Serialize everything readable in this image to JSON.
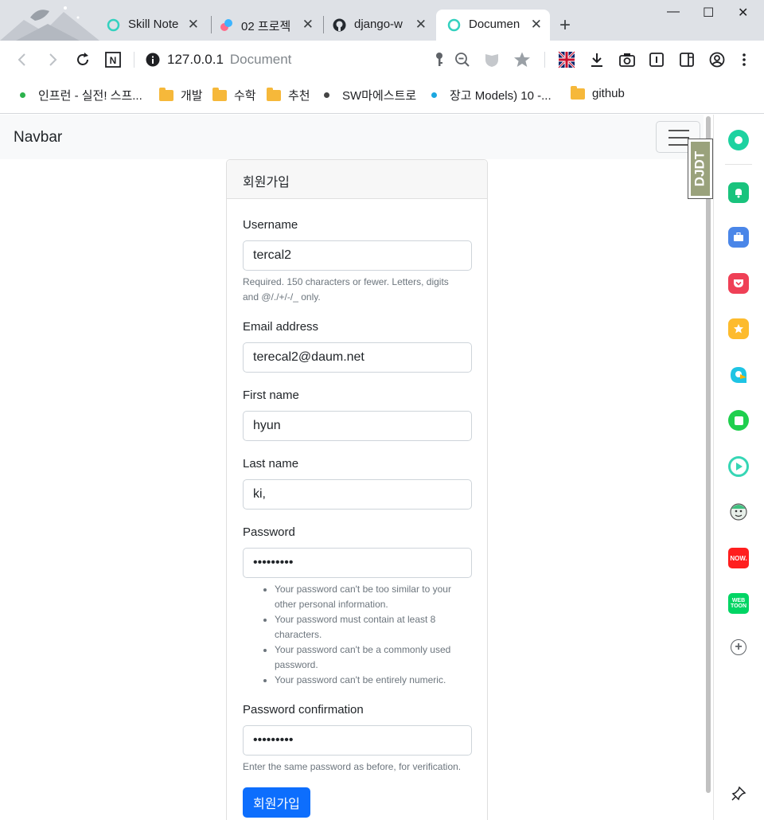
{
  "browser": {
    "tabs": [
      {
        "title": "Skill Note",
        "favicon": "circle-icon",
        "color": "#34d1bf"
      },
      {
        "title": "02 프로젝",
        "favicon": "app-icon",
        "color": "#ff6b8b"
      },
      {
        "title": "django-w",
        "favicon": "github-icon",
        "color": "#24292f"
      },
      {
        "title": "Documen",
        "favicon": "circle-icon",
        "color": "#34d1bf",
        "active": true
      }
    ],
    "new_tab": "+",
    "window_controls": {
      "minimize": "—",
      "maximize": "☐",
      "close": "✕"
    },
    "address": {
      "host": "127.0.0.1",
      "title": "Document"
    },
    "bookmarks": [
      {
        "label": "인프런 - 실전! 스프...",
        "type": "dot",
        "color": "#2cb24c"
      },
      {
        "label": "개발",
        "type": "folder"
      },
      {
        "label": "수학",
        "type": "folder"
      },
      {
        "label": "추천",
        "type": "folder"
      },
      {
        "label": "SW마에스트로",
        "type": "dot",
        "color": "#444444"
      },
      {
        "label": "장고 Models) 10 -...",
        "type": "dot",
        "color": "#1ba7e0"
      },
      {
        "label": "github",
        "type": "folder"
      }
    ]
  },
  "navbar": {
    "brand": "Navbar"
  },
  "form": {
    "title": "회원가입",
    "fields": [
      {
        "label": "Username",
        "value": "tercal2",
        "help": [
          "Required. 150 characters or fewer. Letters, digits",
          "and @/./+/-/_ only."
        ]
      },
      {
        "label": "Email address",
        "value": "terecal2@daum.net"
      },
      {
        "label": "First name",
        "value": "hyun"
      },
      {
        "label": "Last name",
        "value": "ki,"
      },
      {
        "label": "Password",
        "value": "•••••••••"
      },
      {
        "label": "Password confirmation",
        "value": "•••••••••",
        "help": [
          "Enter the same password as before, for verification."
        ]
      }
    ],
    "password_rules": [
      "Your password can't be too similar to your other personal information.",
      "Your password must contain at least 8 characters.",
      "Your password can't be a commonly used password.",
      "Your password can't be entirely numeric."
    ],
    "submit_label": "회원가입",
    "accent_color": "#0d6efd"
  },
  "extension_badge": {
    "text": "DJDT"
  },
  "side_panel": {
    "apps": [
      "whale-icon",
      "bell-icon",
      "briefcase-icon",
      "pocket-icon",
      "star-icon",
      "papago-icon",
      "square-app-icon",
      "play-icon",
      "avatar-icon",
      "now-icon",
      "webtoon-icon",
      "add-icon",
      "pin-icon"
    ],
    "now_label": "NOW.",
    "webtoon_label": "WEB TOON"
  }
}
